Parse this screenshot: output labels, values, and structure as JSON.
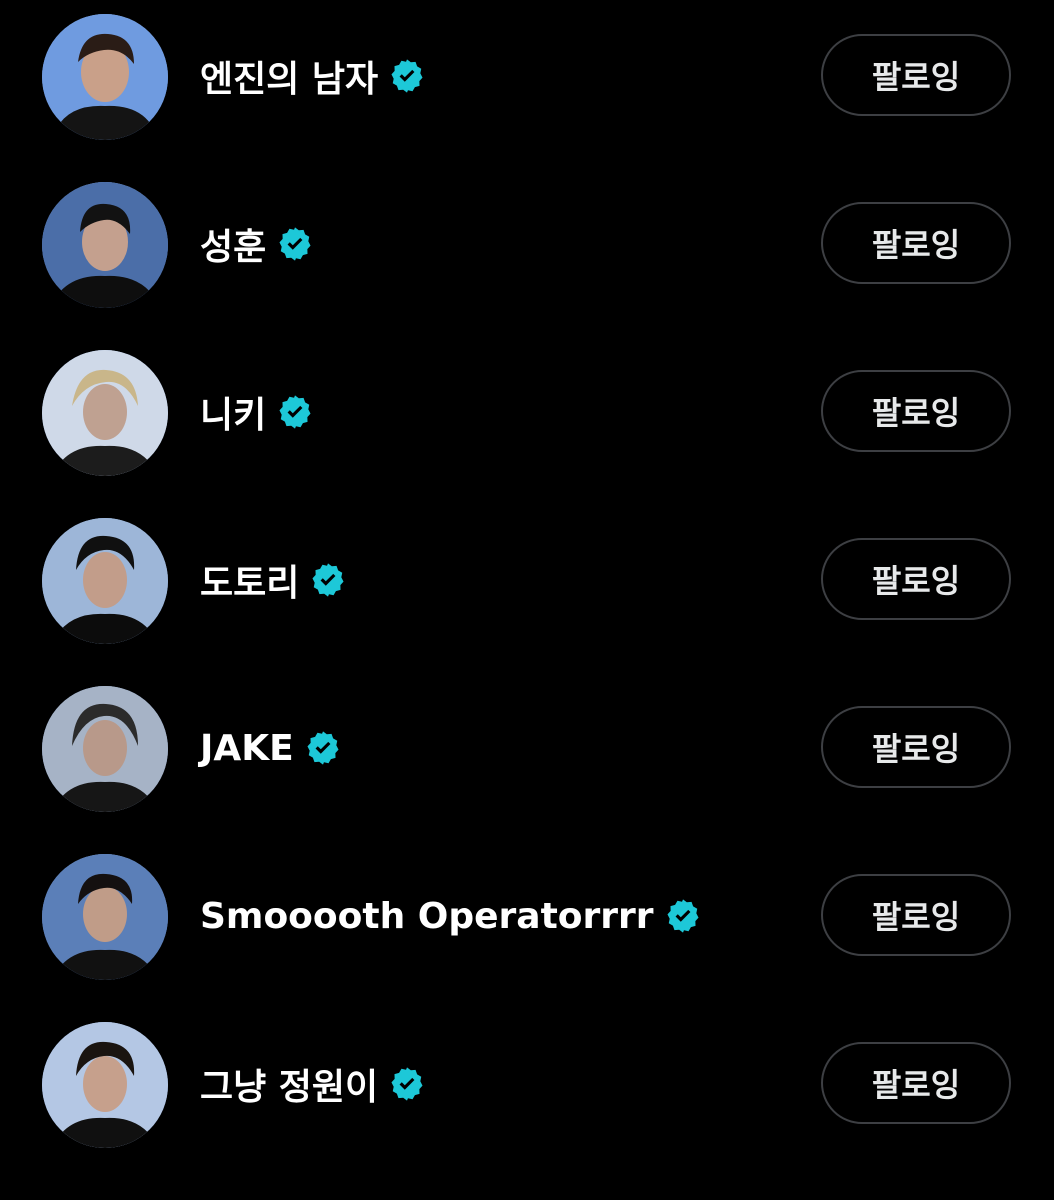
{
  "follow_list": {
    "items": [
      {
        "name": "엔진의 남자",
        "verified": true,
        "button_label": "팔로잉",
        "avatar_icon": "avatar-photo"
      },
      {
        "name": "성훈",
        "verified": true,
        "button_label": "팔로잉",
        "avatar_icon": "avatar-photo"
      },
      {
        "name": "니키",
        "verified": true,
        "button_label": "팔로잉",
        "avatar_icon": "avatar-photo"
      },
      {
        "name": "도토리",
        "verified": true,
        "button_label": "팔로잉",
        "avatar_icon": "avatar-photo"
      },
      {
        "name": "JAKE",
        "verified": true,
        "button_label": "팔로잉",
        "avatar_icon": "avatar-photo"
      },
      {
        "name": "Smooooth Operatorrrr",
        "verified": true,
        "button_label": "팔로잉",
        "avatar_icon": "avatar-photo"
      },
      {
        "name": "그냥 정원이",
        "verified": true,
        "button_label": "팔로잉",
        "avatar_icon": "avatar-photo"
      }
    ]
  },
  "colors": {
    "background": "#000000",
    "text": "#ffffff",
    "verified_badge": "#1DC8D8",
    "button_border": "#3d3f43",
    "button_text": "#e7e9ea"
  },
  "icons": {
    "verified": "verified-badge-icon"
  }
}
